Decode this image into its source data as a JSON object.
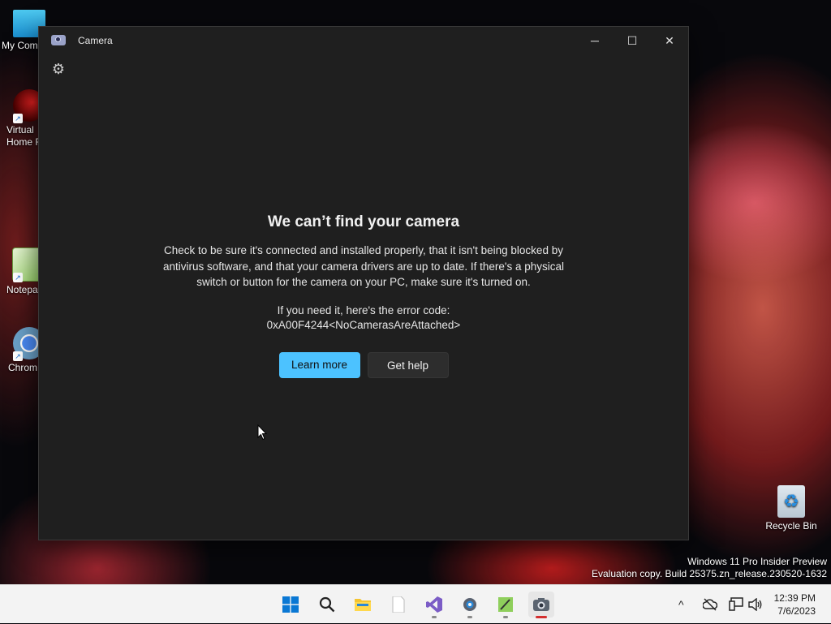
{
  "desktop": {
    "icons": [
      {
        "label": "My Com"
      },
      {
        "label": "Virtual Home F"
      },
      {
        "label": "Notepa"
      },
      {
        "label": "Chrom"
      },
      {
        "label": "Recycle Bin"
      }
    ],
    "watermark": {
      "line1": "Windows 11 Pro Insider Preview",
      "line2": "Evaluation copy. Build 25375.zn_release.230520-1632"
    }
  },
  "window": {
    "title": "Camera",
    "controls": {
      "minimize": "─",
      "maximize": "☐",
      "close": "✕"
    },
    "settings_icon": "⚙"
  },
  "message": {
    "heading": "We can’t find your camera",
    "description": "Check to be sure it's connected and installed properly, that it isn't being blocked by antivirus software, and that your camera drivers are up to date. If there's a physical switch or button for the camera on your PC, make sure it's turned on.",
    "error_intro": "If you need it, here's the error code:",
    "error_code": "0xA00F4244<NoCamerasAreAttached>",
    "learn_more": "Learn more",
    "get_help": "Get help"
  },
  "taskbar": {
    "clock_time": "12:39 PM",
    "clock_date": "7/6/2023",
    "tray_chevron": "^"
  },
  "colors": {
    "accent": "#4cc2ff",
    "window_bg": "#1f1f1f"
  }
}
